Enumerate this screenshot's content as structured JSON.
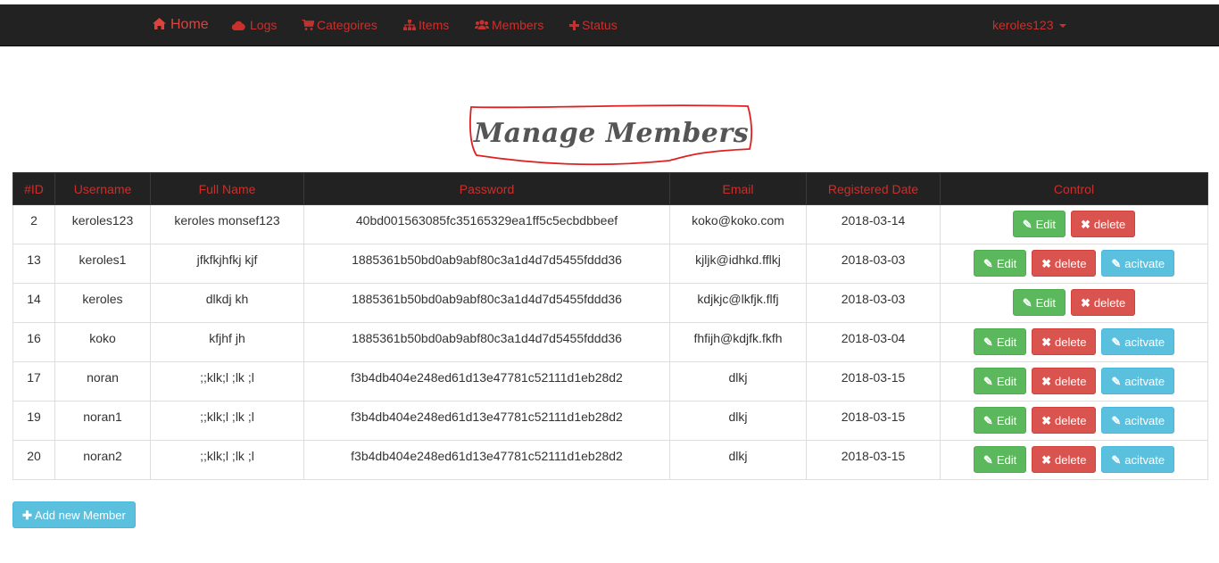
{
  "nav": {
    "home": {
      "label": "Home",
      "icon": "home-icon"
    },
    "logs": {
      "label": "Logs",
      "icon": "cloud-icon"
    },
    "categories": {
      "label": "Categoires",
      "icon": "cart-icon"
    },
    "items": {
      "label": "Items",
      "icon": "sitemap-icon"
    },
    "members": {
      "label": "Members",
      "icon": "users-icon"
    },
    "status": {
      "label": "Status",
      "icon": "plus-icon"
    },
    "user": {
      "label": "keroles123",
      "icon": "caret-down-icon"
    }
  },
  "page": {
    "title": "Manage Members"
  },
  "table": {
    "headers": [
      "#ID",
      "Username",
      "Full Name",
      "Password",
      "Email",
      "Registered Date",
      "Control"
    ],
    "rows": [
      {
        "id": "2",
        "username": "keroles123",
        "fullname": "keroles monsef123",
        "password": "40bd001563085fc35165329ea1ff5c5ecbdbbeef",
        "email": "koko@koko.com",
        "date": "2018-03-14",
        "activate": false
      },
      {
        "id": "13",
        "username": "keroles1",
        "fullname": "jfkfkjhfkj kjf",
        "password": "1885361b50bd0ab9abf80c3a1d4d7d5455fddd36",
        "email": "kjljk@idhkd.fflkj",
        "date": "2018-03-03",
        "activate": true
      },
      {
        "id": "14",
        "username": "keroles",
        "fullname": "dlkdj kh",
        "password": "1885361b50bd0ab9abf80c3a1d4d7d5455fddd36",
        "email": "kdjkjc@lkfjk.flfj",
        "date": "2018-03-03",
        "activate": false
      },
      {
        "id": "16",
        "username": "koko",
        "fullname": "kfjhf jh",
        "password": "1885361b50bd0ab9abf80c3a1d4d7d5455fddd36",
        "email": "fhfijh@kdjfk.fkfh",
        "date": "2018-03-04",
        "activate": true
      },
      {
        "id": "17",
        "username": "noran",
        "fullname": ";;klk;l ;lk ;l",
        "password": "f3b4db404e248ed61d13e47781c52111d1eb28d2",
        "email": "dlkj",
        "date": "2018-03-15",
        "activate": true
      },
      {
        "id": "19",
        "username": "noran1",
        "fullname": ";;klk;l ;lk ;l",
        "password": "f3b4db404e248ed61d13e47781c52111d1eb28d2",
        "email": "dlkj",
        "date": "2018-03-15",
        "activate": true
      },
      {
        "id": "20",
        "username": "noran2",
        "fullname": ";;klk;l ;lk ;l",
        "password": "f3b4db404e248ed61d13e47781c52111d1eb28d2",
        "email": "dlkj",
        "date": "2018-03-15",
        "activate": true
      }
    ],
    "buttons": {
      "edit": "Edit",
      "delete": "delete",
      "activate": "acitvate"
    }
  },
  "add_button": {
    "label": "Add new Member",
    "icon": "plus-icon"
  },
  "colors": {
    "navbar": "#222222",
    "nav_text": "#c9302c",
    "edit": "#5cb85c",
    "delete": "#d9534f",
    "activate": "#5bc0de"
  }
}
